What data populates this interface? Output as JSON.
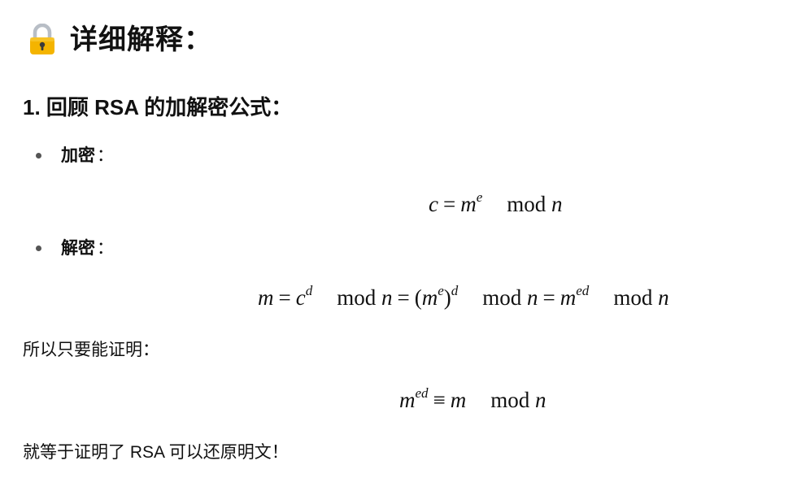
{
  "heading": {
    "title": "详细解释："
  },
  "section1": {
    "title": "1. 回顾 RSA 的加解密公式："
  },
  "bullets": [
    {
      "label": "加密",
      "colon": "："
    },
    {
      "label": "解密",
      "colon": "："
    }
  ],
  "math": {
    "encrypt": {
      "c": "c",
      "eq": "=",
      "m": "m",
      "e": "e",
      "mod": "mod",
      "n": "n"
    },
    "decrypt": {
      "m": "m",
      "eq": "=",
      "c": "c",
      "d": "d",
      "mod": "mod",
      "n": "n",
      "lparen": "(",
      "rparen": ")",
      "e": "e",
      "ed": "ed"
    },
    "congruence": {
      "m": "m",
      "ed": "ed",
      "equiv": "≡",
      "mod": "mod",
      "n": "n"
    }
  },
  "paragraphs": {
    "so_prove": "所以只要能证明：",
    "conclusion": "就等于证明了 RSA 可以还原明文！"
  },
  "icons": {
    "heading_icon": "lock-icon"
  },
  "colors": {
    "lock_body": "#F4B400",
    "lock_shackle": "#B8BEC6",
    "keyhole": "#3A3A3A"
  }
}
